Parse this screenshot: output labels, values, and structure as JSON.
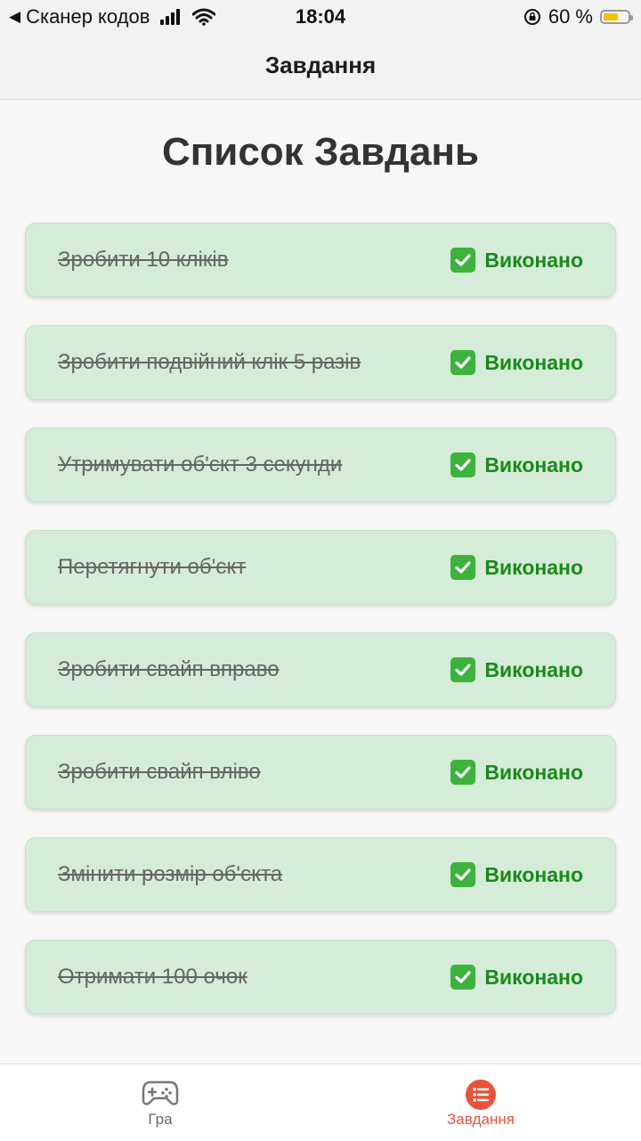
{
  "status_bar": {
    "back_app": "Сканер кодов",
    "time": "18:04",
    "battery": "60 %",
    "battery_level": 0.6
  },
  "nav": {
    "title": "Завдання"
  },
  "page": {
    "heading": "Список Завдань"
  },
  "tasks": [
    {
      "name": "Зробити 10 кліків",
      "status": "Виконано"
    },
    {
      "name": "Зробити подвійний клік 5 разів",
      "status": "Виконано"
    },
    {
      "name": "Утримувати об'єкт 3 секунди",
      "status": "Виконано"
    },
    {
      "name": "Перетягнути об'єкт",
      "status": "Виконано"
    },
    {
      "name": "Зробити свайп вправо",
      "status": "Виконано"
    },
    {
      "name": "Зробити свайп вліво",
      "status": "Виконано"
    },
    {
      "name": "Змінити розмір об'єкта",
      "status": "Виконано"
    },
    {
      "name": "Отримати 100 очок",
      "status": "Виконано"
    }
  ],
  "tabs": [
    {
      "label": "Гра",
      "icon": "gamepad-icon",
      "active": false
    },
    {
      "label": "Завдання",
      "icon": "list-icon",
      "active": true
    }
  ],
  "colors": {
    "card_bg": "#d5ecd8",
    "status_green": "#1a8a1a",
    "active_tab": "#e8533b"
  }
}
